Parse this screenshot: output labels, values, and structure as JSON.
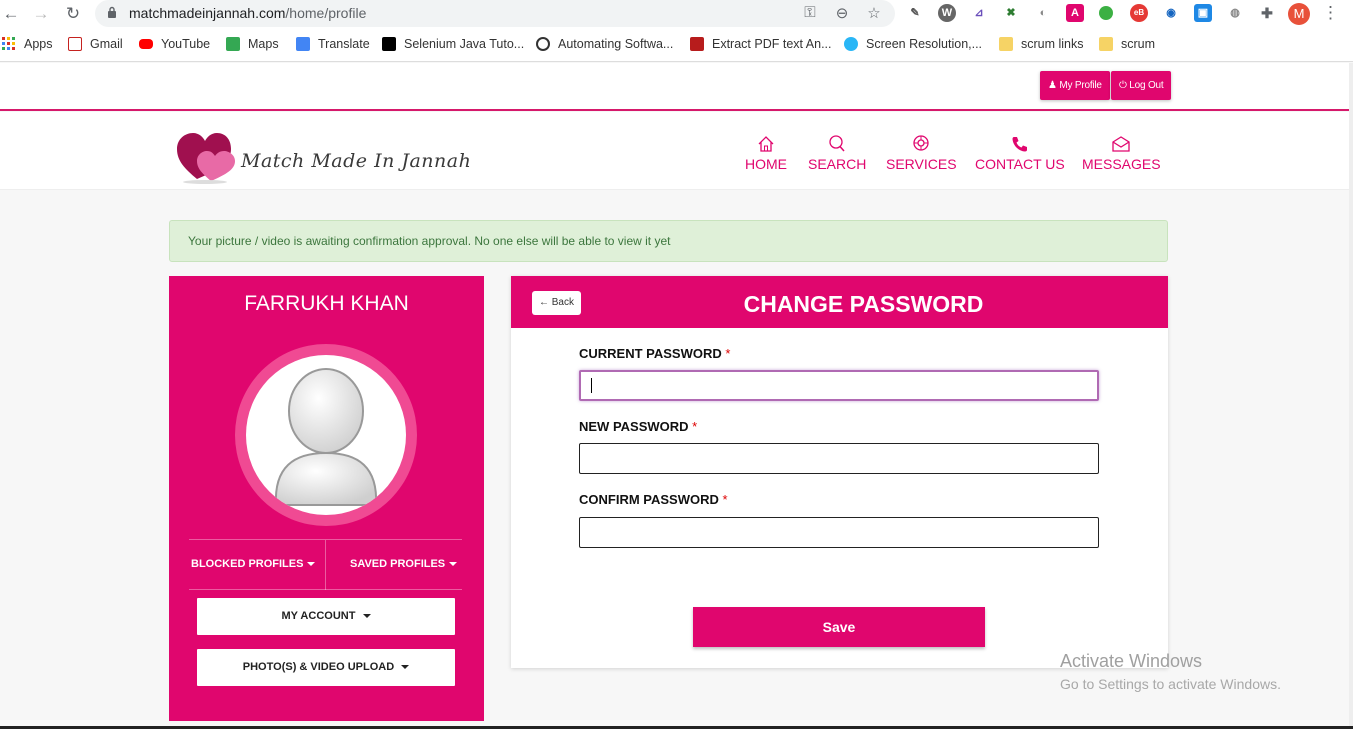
{
  "browser": {
    "url_host": "matchmadeinjannah.com",
    "url_path": "/home/profile",
    "profile_initial": "M"
  },
  "bookmarks": [
    {
      "label": "Apps",
      "icon": "apps-grid-icon",
      "color": "#d93025"
    },
    {
      "label": "Gmail",
      "icon": "gmail-icon",
      "color": "#c5221f"
    },
    {
      "label": "YouTube",
      "icon": "youtube-icon",
      "color": "#ff0000"
    },
    {
      "label": "Maps",
      "icon": "maps-icon",
      "color": "#34a853"
    },
    {
      "label": "Translate",
      "icon": "translate-icon",
      "color": "#4285f4"
    },
    {
      "label": "Selenium Java Tuto...",
      "icon": "dev-icon",
      "color": "#000000"
    },
    {
      "label": "Automating Softwa...",
      "icon": "github-icon",
      "color": "#333333"
    },
    {
      "label": "Extract PDF text An...",
      "icon": "scribd-icon",
      "color": "#b71c1c"
    },
    {
      "label": "Screen Resolution,...",
      "icon": "screen-icon",
      "color": "#29b6f6"
    },
    {
      "label": "scrum links",
      "icon": "folder-icon",
      "color": "#f6d365"
    },
    {
      "label": "scrum",
      "icon": "folder-icon",
      "color": "#f6d365"
    }
  ],
  "topbar": {
    "my_profile": "My Profile",
    "log_out": "Log Out"
  },
  "brand": {
    "name": "Match Made In Jannah",
    "accent": "#e0066e"
  },
  "nav": [
    {
      "label": "HOME",
      "icon": "home-icon"
    },
    {
      "label": "SEARCH",
      "icon": "search-icon"
    },
    {
      "label": "SERVICES",
      "icon": "services-icon"
    },
    {
      "label": "CONTACT US",
      "icon": "phone-icon"
    },
    {
      "label": "MESSAGES",
      "icon": "envelope-icon"
    }
  ],
  "alert": {
    "text": "Your picture / video is awaiting confirmation approval. No one else will be able to view it yet"
  },
  "profile": {
    "name": "FARRUKH KHAN",
    "tabs": [
      "BLOCKED PROFILES",
      "SAVED PROFILES"
    ],
    "my_account": "MY ACCOUNT",
    "upload": "PHOTO(S) & VIDEO UPLOAD"
  },
  "change_password": {
    "back": "Back",
    "title": "CHANGE PASSWORD",
    "current_label": "CURRENT PASSWORD",
    "new_label": "NEW PASSWORD",
    "confirm_label": "CONFIRM PASSWORD",
    "required_mark": "*",
    "current_value": "",
    "new_value": "",
    "confirm_value": "",
    "save": "Save"
  },
  "watermark": {
    "line1": "Activate Windows",
    "line2": "Go to Settings to activate Windows."
  }
}
